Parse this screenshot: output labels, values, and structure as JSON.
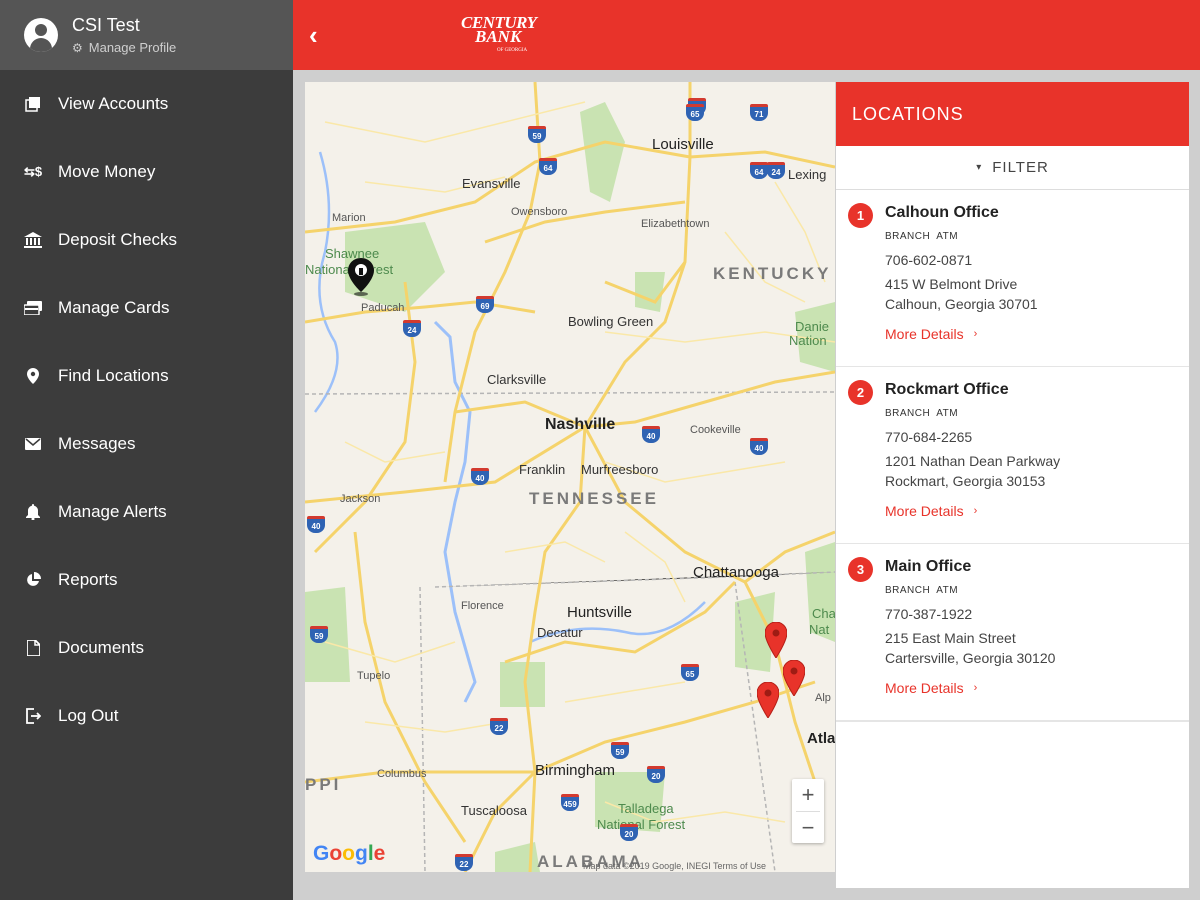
{
  "profile": {
    "name": "CSI Test",
    "manage_label": "Manage Profile"
  },
  "sidebar": {
    "items": [
      {
        "label": "View Accounts",
        "icon": "accounts-icon"
      },
      {
        "label": "Move Money",
        "icon": "transfer-icon"
      },
      {
        "label": "Deposit Checks",
        "icon": "bank-icon"
      },
      {
        "label": "Manage Cards",
        "icon": "cards-icon"
      },
      {
        "label": "Find Locations",
        "icon": "location-pin-icon"
      },
      {
        "label": "Messages",
        "icon": "envelope-icon"
      },
      {
        "label": "Manage Alerts",
        "icon": "bell-icon"
      },
      {
        "label": "Reports",
        "icon": "pie-chart-icon"
      },
      {
        "label": "Documents",
        "icon": "document-icon"
      },
      {
        "label": "Log Out",
        "icon": "logout-icon"
      }
    ]
  },
  "header": {
    "logo_line1": "CENTURY",
    "logo_line2": "BANK",
    "logo_line3": "OF GEORGIA"
  },
  "map": {
    "labels": {
      "louisville": "Louisville",
      "evansville": "Evansville",
      "lexington": "Lexing",
      "owensboro": "Owensboro",
      "marion": "Marion",
      "elizabethtown": "Elizabethtown",
      "shawnee": "Shawnee",
      "national_forest": "National Forest",
      "kentucky": "KENTUCKY",
      "paducah": "Paducah",
      "bowling_green": "Bowling Green",
      "daniel": "Danie",
      "nation": "Nation",
      "clarksville": "Clarksville",
      "nashville": "Nashville",
      "cookeville": "Cookeville",
      "franklin": "Franklin",
      "murfreesboro": "Murfreesboro",
      "jackson": "Jackson",
      "tennessee": "TENNESSEE",
      "chattanooga": "Chattanooga",
      "florence": "Florence",
      "huntsville": "Huntsville",
      "decatur": "Decatur",
      "cha": "Cha",
      "nat": "Nat",
      "tupelo": "Tupelo",
      "alp": "Alp",
      "atla": "Atla",
      "ppi": "PPI",
      "columbus": "Columbus",
      "birmingham": "Birmingham",
      "tuscaloosa": "Tuscaloosa",
      "talladega": "Talladega",
      "talladega_nf": "National Forest",
      "alabama": "ALABAMA"
    },
    "interstates": [
      "65",
      "71",
      "59",
      "64",
      "64",
      "24",
      "69",
      "65",
      "24",
      "40",
      "40",
      "40",
      "65",
      "22",
      "59",
      "20",
      "459",
      "20",
      "22",
      "59",
      "40"
    ],
    "attribution": "Map data ©2019 Google, INEGI   Terms of Use",
    "zoom_in": "+",
    "zoom_out": "−"
  },
  "panel": {
    "title": "LOCATIONS",
    "filter_label": "FILTER",
    "locations": [
      {
        "num": "1",
        "name": "Calhoun Office",
        "tag1": "BRANCH",
        "tag2": "ATM",
        "phone": "706-602-0871",
        "addr1": "415 W Belmont Drive",
        "addr2": "Calhoun, Georgia 30701",
        "more": "More Details"
      },
      {
        "num": "2",
        "name": "Rockmart Office",
        "tag1": "BRANCH",
        "tag2": "ATM",
        "phone": "770-684-2265",
        "addr1": "1201 Nathan Dean Parkway",
        "addr2": "Rockmart, Georgia 30153",
        "more": "More Details"
      },
      {
        "num": "3",
        "name": "Main Office",
        "tag1": "BRANCH",
        "tag2": "ATM",
        "phone": "770-387-1922",
        "addr1": "215 East Main Street",
        "addr2": "Cartersville, Georgia 30120",
        "more": "More Details"
      }
    ]
  },
  "colors": {
    "brand_red": "#e8332a",
    "sidebar_bg": "#3c3c3c",
    "profile_bg": "#555555"
  }
}
